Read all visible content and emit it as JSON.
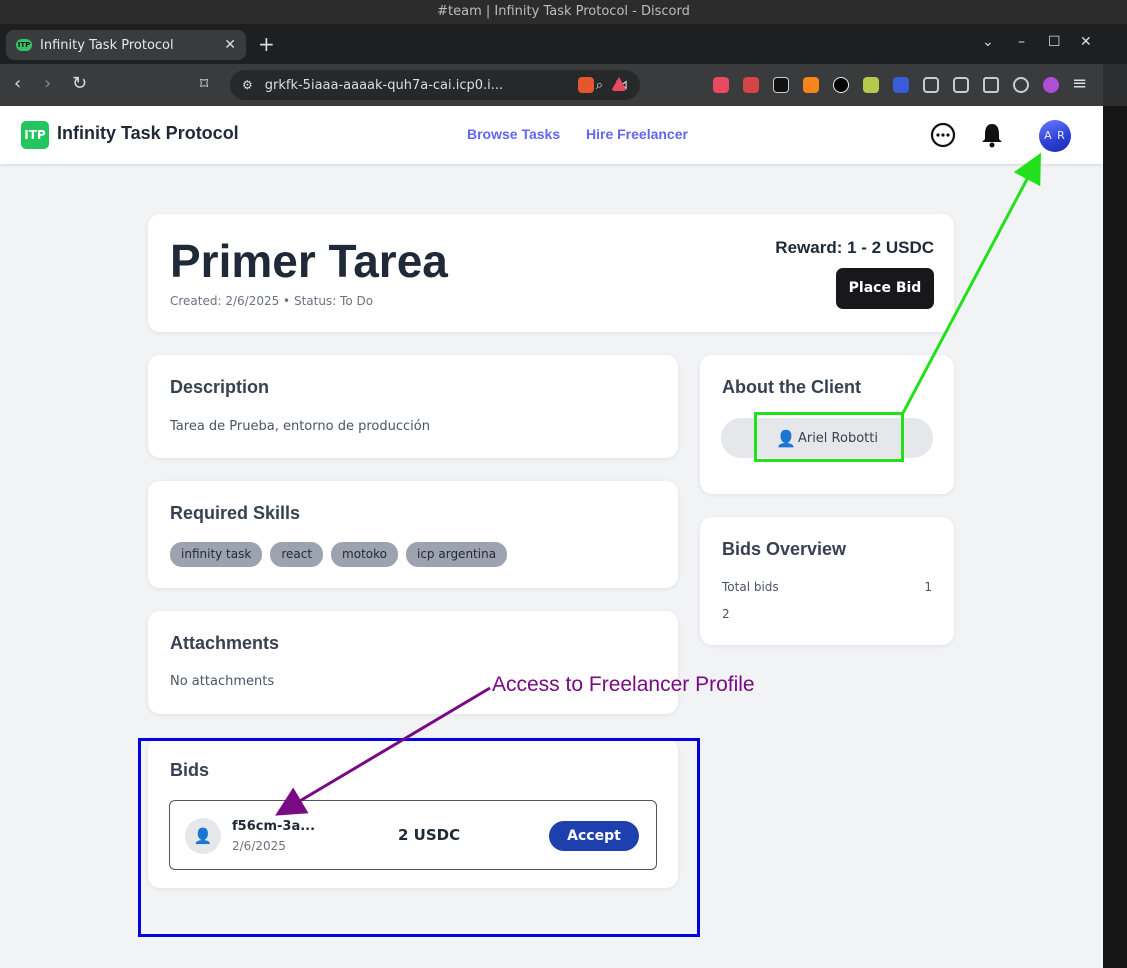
{
  "window": {
    "title": "#team | Infinity Task Protocol - Discord"
  },
  "browser": {
    "tab_title": "Infinity Task Protocol",
    "tab_close": "✕",
    "new_tab": "+",
    "url": "grkfk-5iaaa-aaaak-quh7a-cai.icp0.i...",
    "controls": {
      "minimize": "–",
      "maximize": "☐",
      "close": "✕",
      "dropdown": "⌄"
    }
  },
  "site": {
    "logo_text": "ITP",
    "brand": "Infinity Task Protocol",
    "nav": [
      {
        "label": "Browse Tasks"
      },
      {
        "label": "Hire Freelancer"
      }
    ],
    "user_initials": "A R"
  },
  "task": {
    "title": "Primer Tarea",
    "meta": "Created: 2/6/2025  •  Status: To Do",
    "reward": "Reward: 1 - 2 USDC",
    "place_bid": "Place Bid"
  },
  "description": {
    "heading": "Description",
    "text": "Tarea de Prueba, entorno de producción"
  },
  "skills": {
    "heading": "Required Skills",
    "items": [
      "infinity task",
      "react",
      "motoko",
      "icp argentina"
    ]
  },
  "attachments": {
    "heading": "Attachments",
    "text": "No attachments"
  },
  "client": {
    "heading": "About the Client",
    "name": "Ariel Robotti"
  },
  "bids_overview": {
    "heading": "Bids Overview",
    "total_label": "Total bids",
    "total_value": "1",
    "second_value": "2"
  },
  "bids": {
    "heading": "Bids",
    "items": [
      {
        "id": "f56cm-3a...",
        "date": "2/6/2025",
        "amount": "2 USDC",
        "action": "Accept"
      }
    ]
  },
  "annotations": {
    "freelancer_label": "Access to Freelancer Profile",
    "colors": {
      "green": "#22e01c",
      "blue": "#0000e0",
      "purple": "#7a0a84"
    }
  }
}
